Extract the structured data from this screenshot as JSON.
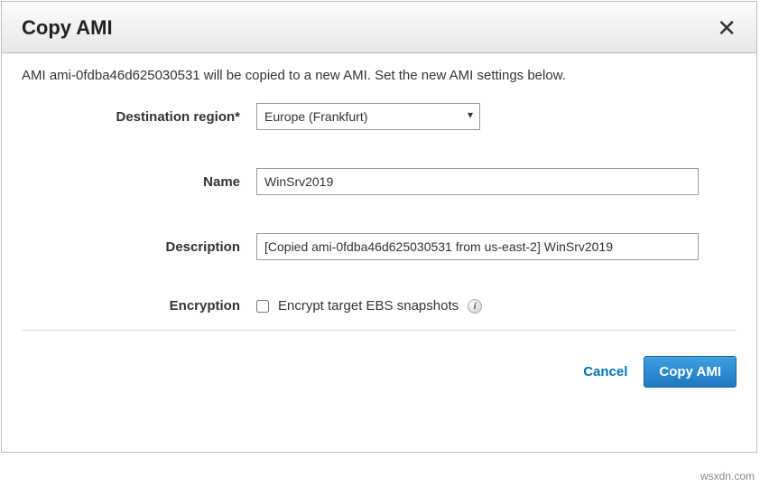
{
  "header": {
    "title": "Copy AMI"
  },
  "intro": "AMI ami-0fdba46d625030531 will be copied to a new AMI. Set the new AMI settings below.",
  "form": {
    "destinationRegion": {
      "label": "Destination region*",
      "value": "Europe (Frankfurt)"
    },
    "name": {
      "label": "Name",
      "value": "WinSrv2019"
    },
    "description": {
      "label": "Description",
      "value": "[Copied ami-0fdba46d625030531 from us-east-2] WinSrv2019"
    },
    "encryption": {
      "label": "Encryption",
      "checkboxLabel": "Encrypt target EBS snapshots"
    }
  },
  "footer": {
    "cancel": "Cancel",
    "copy": "Copy AMI"
  },
  "watermark": "wsxdn.com"
}
